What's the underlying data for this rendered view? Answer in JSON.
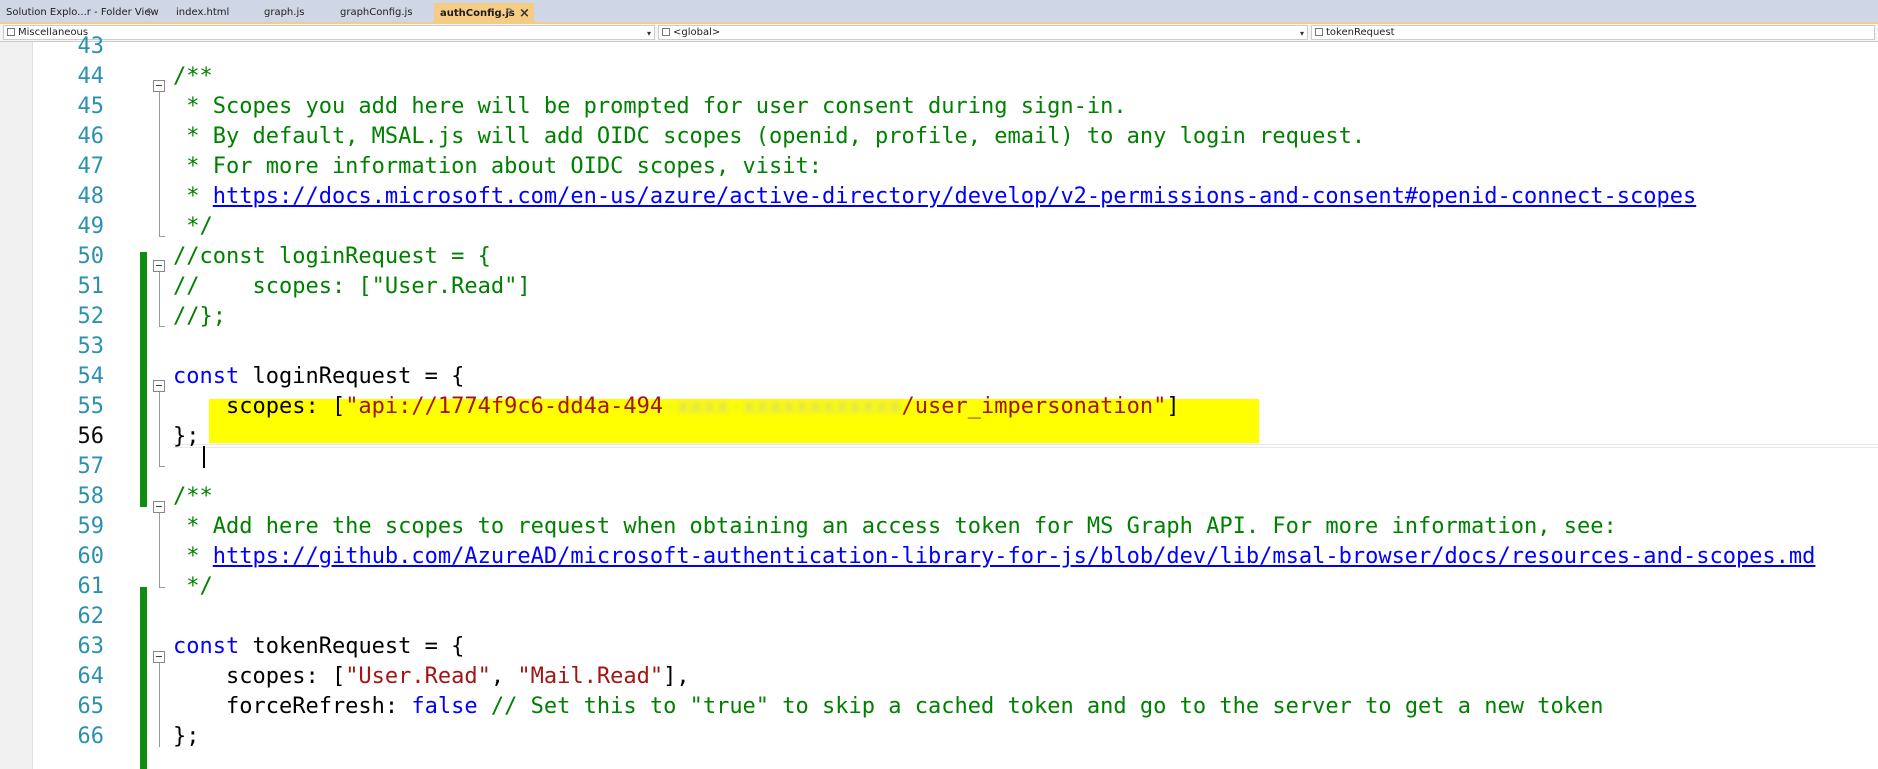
{
  "tabs": [
    {
      "label": "Solution Explo...r - Folder View",
      "pinned": true,
      "active": false
    },
    {
      "label": "index.html",
      "active": false
    },
    {
      "label": "graph.js",
      "active": false
    },
    {
      "label": "graphConfig.js",
      "active": false
    },
    {
      "label": "authConfig.js",
      "active": true
    }
  ],
  "navbar": {
    "project": "Miscellaneous",
    "scope": "<global>",
    "member": "tokenRequest"
  },
  "lines": [
    {
      "num": "43",
      "segments": []
    },
    {
      "num": "44",
      "segments": [
        {
          "t": "/**",
          "c": "cm"
        }
      ]
    },
    {
      "num": "45",
      "segments": [
        {
          "t": " * Scopes you add here will be prompted for user consent during sign-in.",
          "c": "cm"
        }
      ]
    },
    {
      "num": "46",
      "segments": [
        {
          "t": " * By default, MSAL.js will add OIDC scopes (openid, profile, email) to any login request.",
          "c": "cm"
        }
      ]
    },
    {
      "num": "47",
      "segments": [
        {
          "t": " * For more information about OIDC scopes, visit:",
          "c": "cm"
        }
      ]
    },
    {
      "num": "48",
      "segments": [
        {
          "t": " * ",
          "c": "cm"
        },
        {
          "t": "https://docs.microsoft.com/en-us/azure/active-directory/develop/v2-permissions-and-consent#openid-connect-scopes",
          "c": "lnk"
        }
      ]
    },
    {
      "num": "49",
      "segments": [
        {
          "t": " */",
          "c": "cm"
        }
      ]
    },
    {
      "num": "50",
      "segments": [
        {
          "t": "//const loginRequest = {",
          "c": "cm"
        }
      ]
    },
    {
      "num": "51",
      "segments": [
        {
          "t": "//    scopes: [\"User.Read\"]",
          "c": "cm"
        }
      ]
    },
    {
      "num": "52",
      "segments": [
        {
          "t": "//};",
          "c": "cm"
        }
      ]
    },
    {
      "num": "53",
      "segments": []
    },
    {
      "num": "54",
      "segments": [
        {
          "t": "const",
          "c": "kw"
        },
        {
          "t": " loginRequest = {",
          "c": ""
        }
      ]
    },
    {
      "num": "55",
      "segments": [
        {
          "t": "    scopes: [",
          "c": ""
        },
        {
          "t": "\"api://1774f9c6-dd4a-494",
          "c": "str"
        },
        {
          "t": "-xxxx-xxxxxxxxxxxx",
          "c": "blur"
        },
        {
          "t": "/user_impersonation\"",
          "c": "str"
        },
        {
          "t": "]",
          "c": ""
        }
      ]
    },
    {
      "num": "56",
      "segments": [
        {
          "t": "};",
          "c": ""
        }
      ]
    },
    {
      "num": "57",
      "segments": []
    },
    {
      "num": "58",
      "segments": [
        {
          "t": "/**",
          "c": "cm"
        }
      ]
    },
    {
      "num": "59",
      "segments": [
        {
          "t": " * Add here the scopes to request when obtaining an access token for MS Graph API. For more information, see:",
          "c": "cm"
        }
      ]
    },
    {
      "num": "60",
      "segments": [
        {
          "t": " * ",
          "c": "cm"
        },
        {
          "t": "https://github.com/AzureAD/microsoft-authentication-library-for-js/blob/dev/lib/msal-browser/docs/resources-and-scopes.md",
          "c": "lnk"
        }
      ]
    },
    {
      "num": "61",
      "segments": [
        {
          "t": " */",
          "c": "cm"
        }
      ]
    },
    {
      "num": "62",
      "segments": []
    },
    {
      "num": "63",
      "segments": [
        {
          "t": "const",
          "c": "kw"
        },
        {
          "t": " tokenRequest = {",
          "c": ""
        }
      ]
    },
    {
      "num": "64",
      "segments": [
        {
          "t": "    scopes: [",
          "c": ""
        },
        {
          "t": "\"User.Read\"",
          "c": "str"
        },
        {
          "t": ", ",
          "c": ""
        },
        {
          "t": "\"Mail.Read\"",
          "c": "str"
        },
        {
          "t": "],",
          "c": ""
        }
      ]
    },
    {
      "num": "65",
      "segments": [
        {
          "t": "    forceRefresh: ",
          "c": ""
        },
        {
          "t": "false",
          "c": "kw"
        },
        {
          "t": " // Set this to \"true\" to skip a cached token and go to the server to get a new token",
          "c": "cm"
        }
      ]
    },
    {
      "num": "66",
      "segments": [
        {
          "t": "};",
          "c": ""
        }
      ]
    }
  ],
  "current_line": "56",
  "colors": {
    "comment": "#008000",
    "keyword": "#0000ff",
    "string": "#a31515",
    "line_number": "#2b91af",
    "change_bar": "#118c11",
    "highlight": "#ffff00",
    "active_tab": "#f5cc84"
  }
}
